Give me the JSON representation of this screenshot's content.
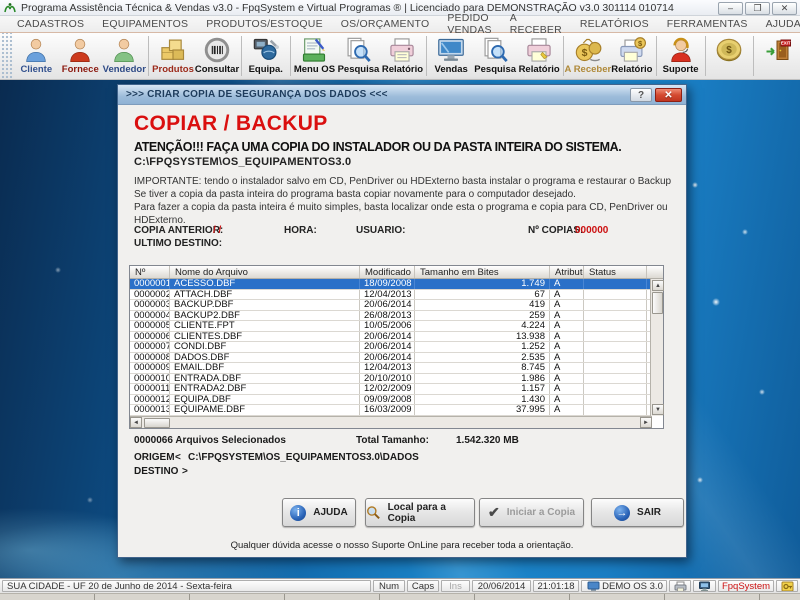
{
  "window": {
    "title": "Programa Assistência Técnica & Vendas v3.0 - FpqSystem e Virtual Programas ® | Licenciado para  DEMONSTRAÇÃO v3.0 301114 010714",
    "controls": {
      "minimize": "–",
      "restore": "❐",
      "close": "✕"
    }
  },
  "menu": {
    "items": [
      "CADASTROS",
      "EQUIPAMENTOS",
      "PRODUTOS/ESTOQUE",
      "OS/ORÇAMENTO",
      "PEDIDO VENDAS",
      "A RECEBER",
      "RELATÓRIOS",
      "FERRAMENTAS",
      "AJUDA"
    ]
  },
  "toolbar": {
    "buttons": [
      {
        "label": "Cliente",
        "label_color": "#33518e"
      },
      {
        "label": "Fornece",
        "label_color": "#8c1a10"
      },
      {
        "label": "Vendedor",
        "label_color": "#2e4a86"
      },
      {
        "label": "Produtos",
        "label_color": "#9c2a1a"
      },
      {
        "label": "Consultar",
        "label_color": "#111111"
      },
      {
        "label": "Equipa.",
        "label_color": "#111111"
      },
      {
        "label": "Menu OS",
        "label_color": "#111111"
      },
      {
        "label": "Pesquisa",
        "label_color": "#111111"
      },
      {
        "label": "Relatório",
        "label_color": "#111111"
      },
      {
        "label": "Vendas",
        "label_color": "#111111"
      },
      {
        "label": "Pesquisa",
        "label_color": "#111111"
      },
      {
        "label": "Relatório",
        "label_color": "#111111"
      },
      {
        "label": "A Receber",
        "label_color": "#b08a3a"
      },
      {
        "label": "Relatório",
        "label_color": "#111111"
      },
      {
        "label": "Suporte",
        "label_color": "#111111"
      }
    ]
  },
  "icons": {
    "exit_label": "EXIT",
    "dollar": "$"
  },
  "dialog": {
    "title": ">>> CRIAR COPIA DE SEGURANÇA DOS DADOS <<<",
    "help_glyph": "?",
    "close_glyph": "✕",
    "heading": "COPIAR / BACKUP",
    "attention": "ATENÇÃO!!!   FAÇA UMA COPIA DO INSTALADOR OU DA PASTA INTEIRA DO SISTEMA.",
    "system_path": "C:\\FPQSYSTEM\\OS_EQUIPAMENTOS3.0",
    "info_lines": [
      "IMPORTANTE: tendo o instalador salvo em CD, PenDriver ou HDExterno basta instalar o programa e restaurar o Backup",
      "Se tiver a copia da pasta inteira do programa basta copiar novamente para o computador desejado.",
      "Para fazer a copia da pasta inteira é muito simples, basta localizar onde esta o programa e copia para CD, PenDriver ou HDExterno."
    ],
    "fields": {
      "copia_anterior_label": "COPIA ANTERIOR:",
      "copia_anterior_value": "/ /",
      "hora_label": "HORA:",
      "usuario_label": "USUARIO:",
      "n_copias_label": "Nº COPIAS:",
      "n_copias_value": "000000",
      "ultimo_destino_label": "ULTIMO DESTINO:"
    },
    "table": {
      "columns": [
        "Nº",
        "Nome do Arquivo",
        "Modificado",
        "Tamanho em Bites",
        "Atributo",
        "Status"
      ],
      "selected_index": 0,
      "rows": [
        [
          "0000001",
          "ACESSO.DBF",
          "18/09/2008",
          "1.749",
          "A",
          ""
        ],
        [
          "0000002",
          "ATTACH.DBF",
          "12/04/2013",
          "67",
          "A",
          ""
        ],
        [
          "0000003",
          "BACKUP.DBF",
          "20/06/2014",
          "419",
          "A",
          ""
        ],
        [
          "0000004",
          "BACKUP2.DBF",
          "26/08/2013",
          "259",
          "A",
          ""
        ],
        [
          "0000005",
          "CLIENTE.FPT",
          "10/05/2006",
          "4.224",
          "A",
          ""
        ],
        [
          "0000006",
          "CLIENTES.DBF",
          "20/06/2014",
          "13.938",
          "A",
          ""
        ],
        [
          "0000007",
          "CONDI.DBF",
          "20/06/2014",
          "1.252",
          "A",
          ""
        ],
        [
          "0000008",
          "DADOS.DBF",
          "20/06/2014",
          "2.535",
          "A",
          ""
        ],
        [
          "0000009",
          "EMAIL.DBF",
          "12/04/2013",
          "8.745",
          "A",
          ""
        ],
        [
          "0000010",
          "ENTRADA.DBF",
          "20/10/2010",
          "1.986",
          "A",
          ""
        ],
        [
          "0000011",
          "ENTRADA2.DBF",
          "12/02/2009",
          "1.157",
          "A",
          ""
        ],
        [
          "0000012",
          "EQUIPA.DBF",
          "09/09/2008",
          "1.430",
          "A",
          ""
        ],
        [
          "0000013",
          "EQUIPAME.DBF",
          "16/03/2009",
          "37.995",
          "A",
          ""
        ]
      ],
      "scroll_glyphs": {
        "up": "▲",
        "down": "▼",
        "left": "◄",
        "right": "►"
      }
    },
    "summary": {
      "selected_files": "0000066 Arquivos Selecionados",
      "total_label": "Total Tamanho:",
      "total_value": "1.542.320 MB",
      "origem_label": "ORIGEM",
      "origem_arrow": "<",
      "origem_value": "C:\\FPQSYSTEM\\OS_EQUIPAMENTOS3.0\\DADOS",
      "destino_label": "DESTINO",
      "destino_arrow": ">"
    },
    "buttons": {
      "ajuda": "AJUDA",
      "ajuda_glyph": "i",
      "local": "Local para a Copia",
      "iniciar": "Iniciar a Copia",
      "iniciar_glyph": "✔",
      "sair": "SAIR",
      "sair_glyph": "→"
    },
    "footer_note": "Qualquer dúvida acesse o nosso Suporte OnLine para receber toda a orientação."
  },
  "statusbar": {
    "city": "SUA CIDADE - UF 20 de Junho de 2014 - Sexta-feira",
    "num": "Num",
    "caps": "Caps",
    "ins": "Ins",
    "date": "20/06/2014",
    "time": "21:01:18",
    "demo": "DEMO OS 3.0",
    "brand": "FpqSystem"
  },
  "colors": {
    "accent_red": "#da0f0f",
    "value_red": "#cc1111",
    "selection_blue": "#2a70c8",
    "dialog_title_blue": "#9dbcda"
  }
}
